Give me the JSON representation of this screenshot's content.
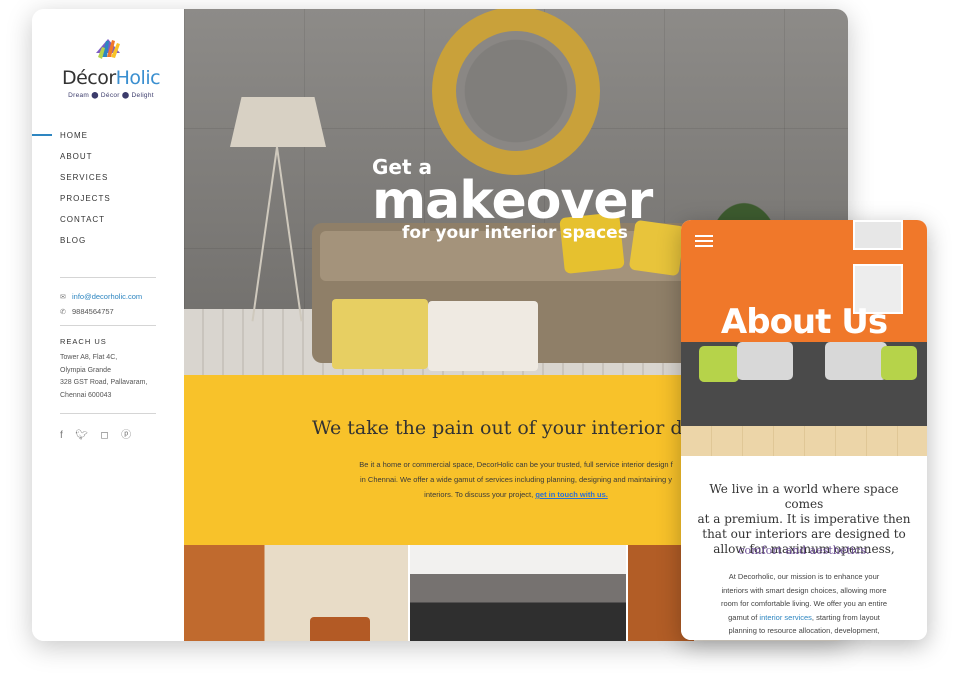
{
  "desktop": {
    "logo": {
      "brand_a": "Décor",
      "brand_b": "Holic",
      "tagline": "Dream ⬤ Décor ⬤ Delight"
    },
    "nav": [
      {
        "label": "HOME",
        "active": true
      },
      {
        "label": "ABOUT",
        "active": false
      },
      {
        "label": "SERVICES",
        "active": false
      },
      {
        "label": "PROJECTS",
        "active": false
      },
      {
        "label": "CONTACT",
        "active": false
      },
      {
        "label": "BLOG",
        "active": false
      }
    ],
    "contact": {
      "email": "info@decorholic.com",
      "phone": "9884564757"
    },
    "reach": {
      "heading": "REACH US",
      "lines": [
        "Tower A8, Flat 4C,",
        "Olympia Grande",
        "328 GST Road, Pallavaram,",
        "Chennai 600043"
      ]
    },
    "social": [
      "facebook-icon",
      "twitter-icon",
      "instagram-icon",
      "pinterest-icon"
    ],
    "hero": {
      "line1": "Get a",
      "line2": "makeover",
      "line3": "for your interior spaces"
    },
    "intro": {
      "heading": "We take the pain out of your interior design w",
      "paragraph_lines": [
        "Be it a home or commercial space, DecorHolic can be your trusted, full service interior design f",
        "in Chennai. We offer a wide gamut of services including planning, designing and maintaining y",
        "interiors. To discuss your project,"
      ],
      "link": "get in touch with us."
    },
    "colors": {
      "accent": "#2e86c1",
      "yellow": "#f8c22a"
    }
  },
  "mobile": {
    "hero_title": "About Us",
    "heading_lines": [
      "We live in a world where space comes",
      "at a premium. It is imperative then",
      "that our interiors are designed to",
      "allow for maximum openness,"
    ],
    "subheading": "comfort and aesthetics.",
    "para_lines": [
      "At Decorholic, our mission is to enhance your",
      "interiors with smart design choices, allowing more",
      "room for comfortable living. We offer you an entire"
    ],
    "para_pre": "gamut of",
    "para_link": "interior services",
    "para_post": ", starting from layout",
    "para_last": "planning to resource allocation, development,",
    "colors": {
      "orange": "#f0782a",
      "purple": "#6a4c93"
    }
  }
}
